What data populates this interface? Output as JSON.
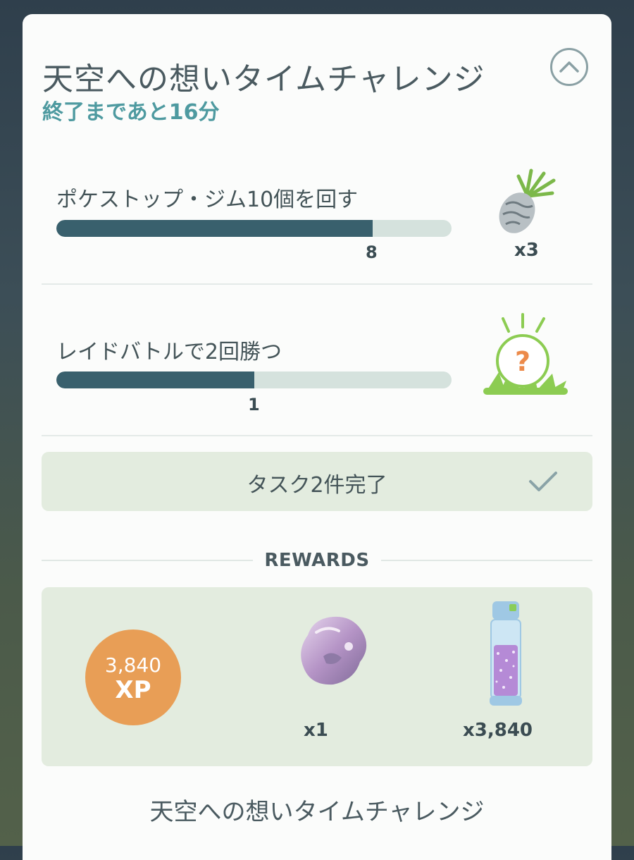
{
  "challenge": {
    "title": "天空への想いタイムチャレンジ",
    "time_left": "終了まであと16分"
  },
  "tasks": [
    {
      "label": "ポケストップ・ジム10個を回す",
      "progress": 8,
      "goal": 10,
      "progress_text": "8",
      "reward_icon": "silver-berry-icon",
      "reward_count": "x3"
    },
    {
      "label": "レイドバトルで2回勝つ",
      "progress": 1,
      "goal": 2,
      "progress_text": "1",
      "reward_icon": "mystery-encounter-icon",
      "reward_count": ""
    }
  ],
  "completion": {
    "label": "タスク2件完了",
    "icon": "check-icon"
  },
  "rewards": {
    "heading": "REWARDS",
    "xp": {
      "value": "3,840",
      "unit": "XP"
    },
    "items": [
      {
        "icon": "crystal-ore-icon",
        "count": "x1"
      },
      {
        "icon": "stardust-vial-icon",
        "count": "x3,840"
      }
    ]
  },
  "footer": {
    "title": "天空への想いタイムチャレンジ"
  },
  "colors": {
    "accent": "#4e9aa0",
    "bar_fill": "#39606d",
    "bar_track": "#d5e2dd",
    "xp_orange": "#e89e56",
    "panel_green": "#e3ecdf"
  }
}
